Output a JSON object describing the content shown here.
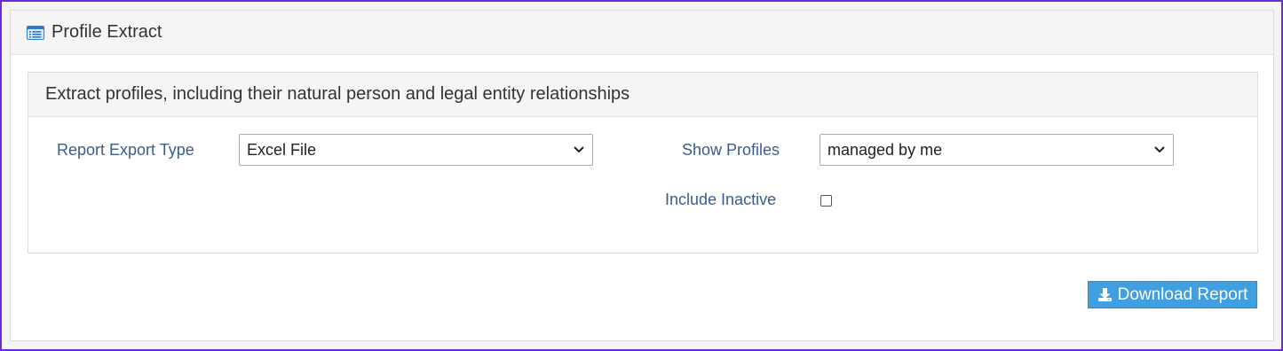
{
  "panel": {
    "title": "Profile Extract",
    "icon": "list-card-icon"
  },
  "section": {
    "title": "Extract profiles, including their natural person and legal entity relationships"
  },
  "form": {
    "export_type": {
      "label": "Report Export Type",
      "value": "Excel File"
    },
    "show_profiles": {
      "label": "Show Profiles",
      "value": "managed by me"
    },
    "include_inactive": {
      "label": "Include Inactive",
      "checked": false
    }
  },
  "actions": {
    "download_label": "Download Report",
    "download_icon": "download-icon"
  },
  "colors": {
    "label_text": "#3a5d8c",
    "button_bg": "#3f9fe0",
    "frame_border": "#6a2cd6"
  }
}
